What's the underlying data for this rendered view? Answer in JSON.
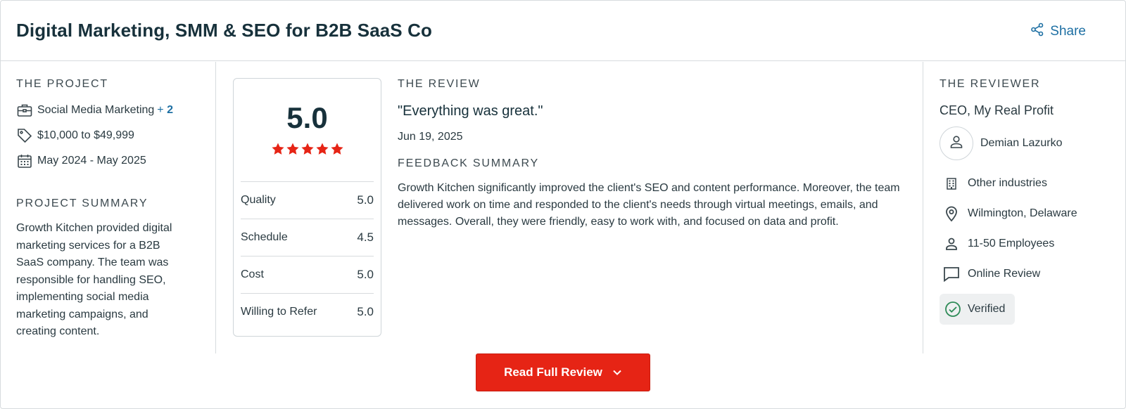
{
  "header": {
    "title": "Digital Marketing, SMM & SEO for B2B SaaS Co",
    "share_label": "Share"
  },
  "project": {
    "section_label": "THE PROJECT",
    "service": "Social Media Marketing",
    "service_more_prefix": "+",
    "service_more_count": "2",
    "budget": "$10,000 to $49,999",
    "dates": "May 2024 - May 2025",
    "summary_label": "PROJECT SUMMARY",
    "summary": "Growth Kitchen provided digital marketing services for a B2B SaaS company. The team was responsible for handling SEO, implementing social media marketing campaigns, and creating content."
  },
  "rating": {
    "overall": "5.0",
    "stars": 5,
    "rows": [
      {
        "label": "Quality",
        "value": "5.0"
      },
      {
        "label": "Schedule",
        "value": "4.5"
      },
      {
        "label": "Cost",
        "value": "5.0"
      },
      {
        "label": "Willing to Refer",
        "value": "5.0"
      }
    ]
  },
  "review": {
    "section_label": "THE REVIEW",
    "quote": "\"Everything was great.\"",
    "date": "Jun 19, 2025",
    "feedback_label": "FEEDBACK SUMMARY",
    "feedback": "Growth Kitchen significantly improved the client's SEO and content performance. Moreover, the team delivered work on time and responded to the client's needs through virtual meetings, emails, and messages. Overall, they were friendly, easy to work with, and focused on data and profit."
  },
  "reviewer": {
    "section_label": "THE REVIEWER",
    "title": "CEO, My Real Profit",
    "name": "Demian Lazurko",
    "industry": "Other industries",
    "location": "Wilmington, Delaware",
    "size": "11-50 Employees",
    "review_type": "Online Review",
    "verified": "Verified"
  },
  "actions": {
    "read_full_review": "Read Full Review"
  },
  "colors": {
    "accent_red": "#e62415",
    "link_blue": "#1d6fa3",
    "star_red": "#e62415",
    "verified_green": "#2e8b57"
  }
}
